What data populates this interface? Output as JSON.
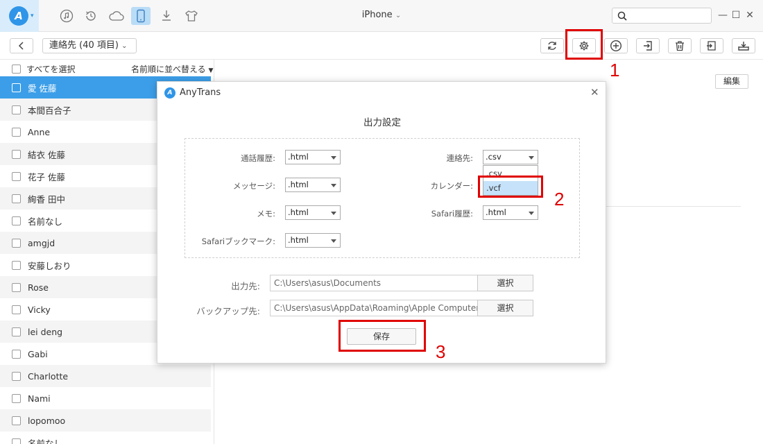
{
  "topbar": {
    "device_title": "iPhone",
    "icons": [
      "music-icon",
      "history-icon",
      "cloud-icon",
      "phone-icon",
      "download-icon",
      "tshirt-icon"
    ]
  },
  "toolbar": {
    "category": "連絡先 (40 項目)",
    "icons": [
      "refresh-icon",
      "settings-icon",
      "add-icon",
      "export-icon",
      "delete-icon",
      "import-icon",
      "tray-icon"
    ]
  },
  "list": {
    "select_all": "すべてを選択",
    "sort_label": "名前順に並べ替える",
    "contacts": [
      "愛 佐藤",
      "本間百合子",
      "Anne",
      "結衣 佐藤",
      "花子 佐藤",
      "絢香 田中",
      "名前なし",
      "amgjd",
      "安藤しおり",
      "Rose",
      "Vicky",
      "lei deng",
      "Gabi",
      "Charlotte",
      "Nami",
      "lopomoo",
      "名前なし"
    ]
  },
  "detail": {
    "edit_label": "編集"
  },
  "dialog": {
    "app_name": "AnyTrans",
    "heading": "出力設定",
    "fields": {
      "call_history": {
        "label": "通話履歴:",
        "value": ".html"
      },
      "messages": {
        "label": "メッセージ:",
        "value": ".html"
      },
      "notes": {
        "label": "メモ:",
        "value": ".html"
      },
      "safari_bookmarks": {
        "label": "Safariブックマーク:",
        "value": ".html"
      },
      "contacts": {
        "label": "連絡先:",
        "value": ".csv"
      },
      "calendar": {
        "label": "カレンダー:"
      },
      "safari_history": {
        "label": "Safari履歴:",
        "value": ".html"
      }
    },
    "dropdown_options": [
      ".csv",
      ".vcf"
    ],
    "output_label": "出力先:",
    "output_path": "C:\\Users\\asus\\Documents",
    "backup_label": "バックアップ先:",
    "backup_path": "C:\\Users\\asus\\AppData\\Roaming\\Apple Computer",
    "choose_label": "選択",
    "save_label": "保存"
  },
  "annotations": [
    "1",
    "2",
    "3"
  ],
  "colors": {
    "accent": "#3c9ee8",
    "highlight_box": "#e00000"
  }
}
